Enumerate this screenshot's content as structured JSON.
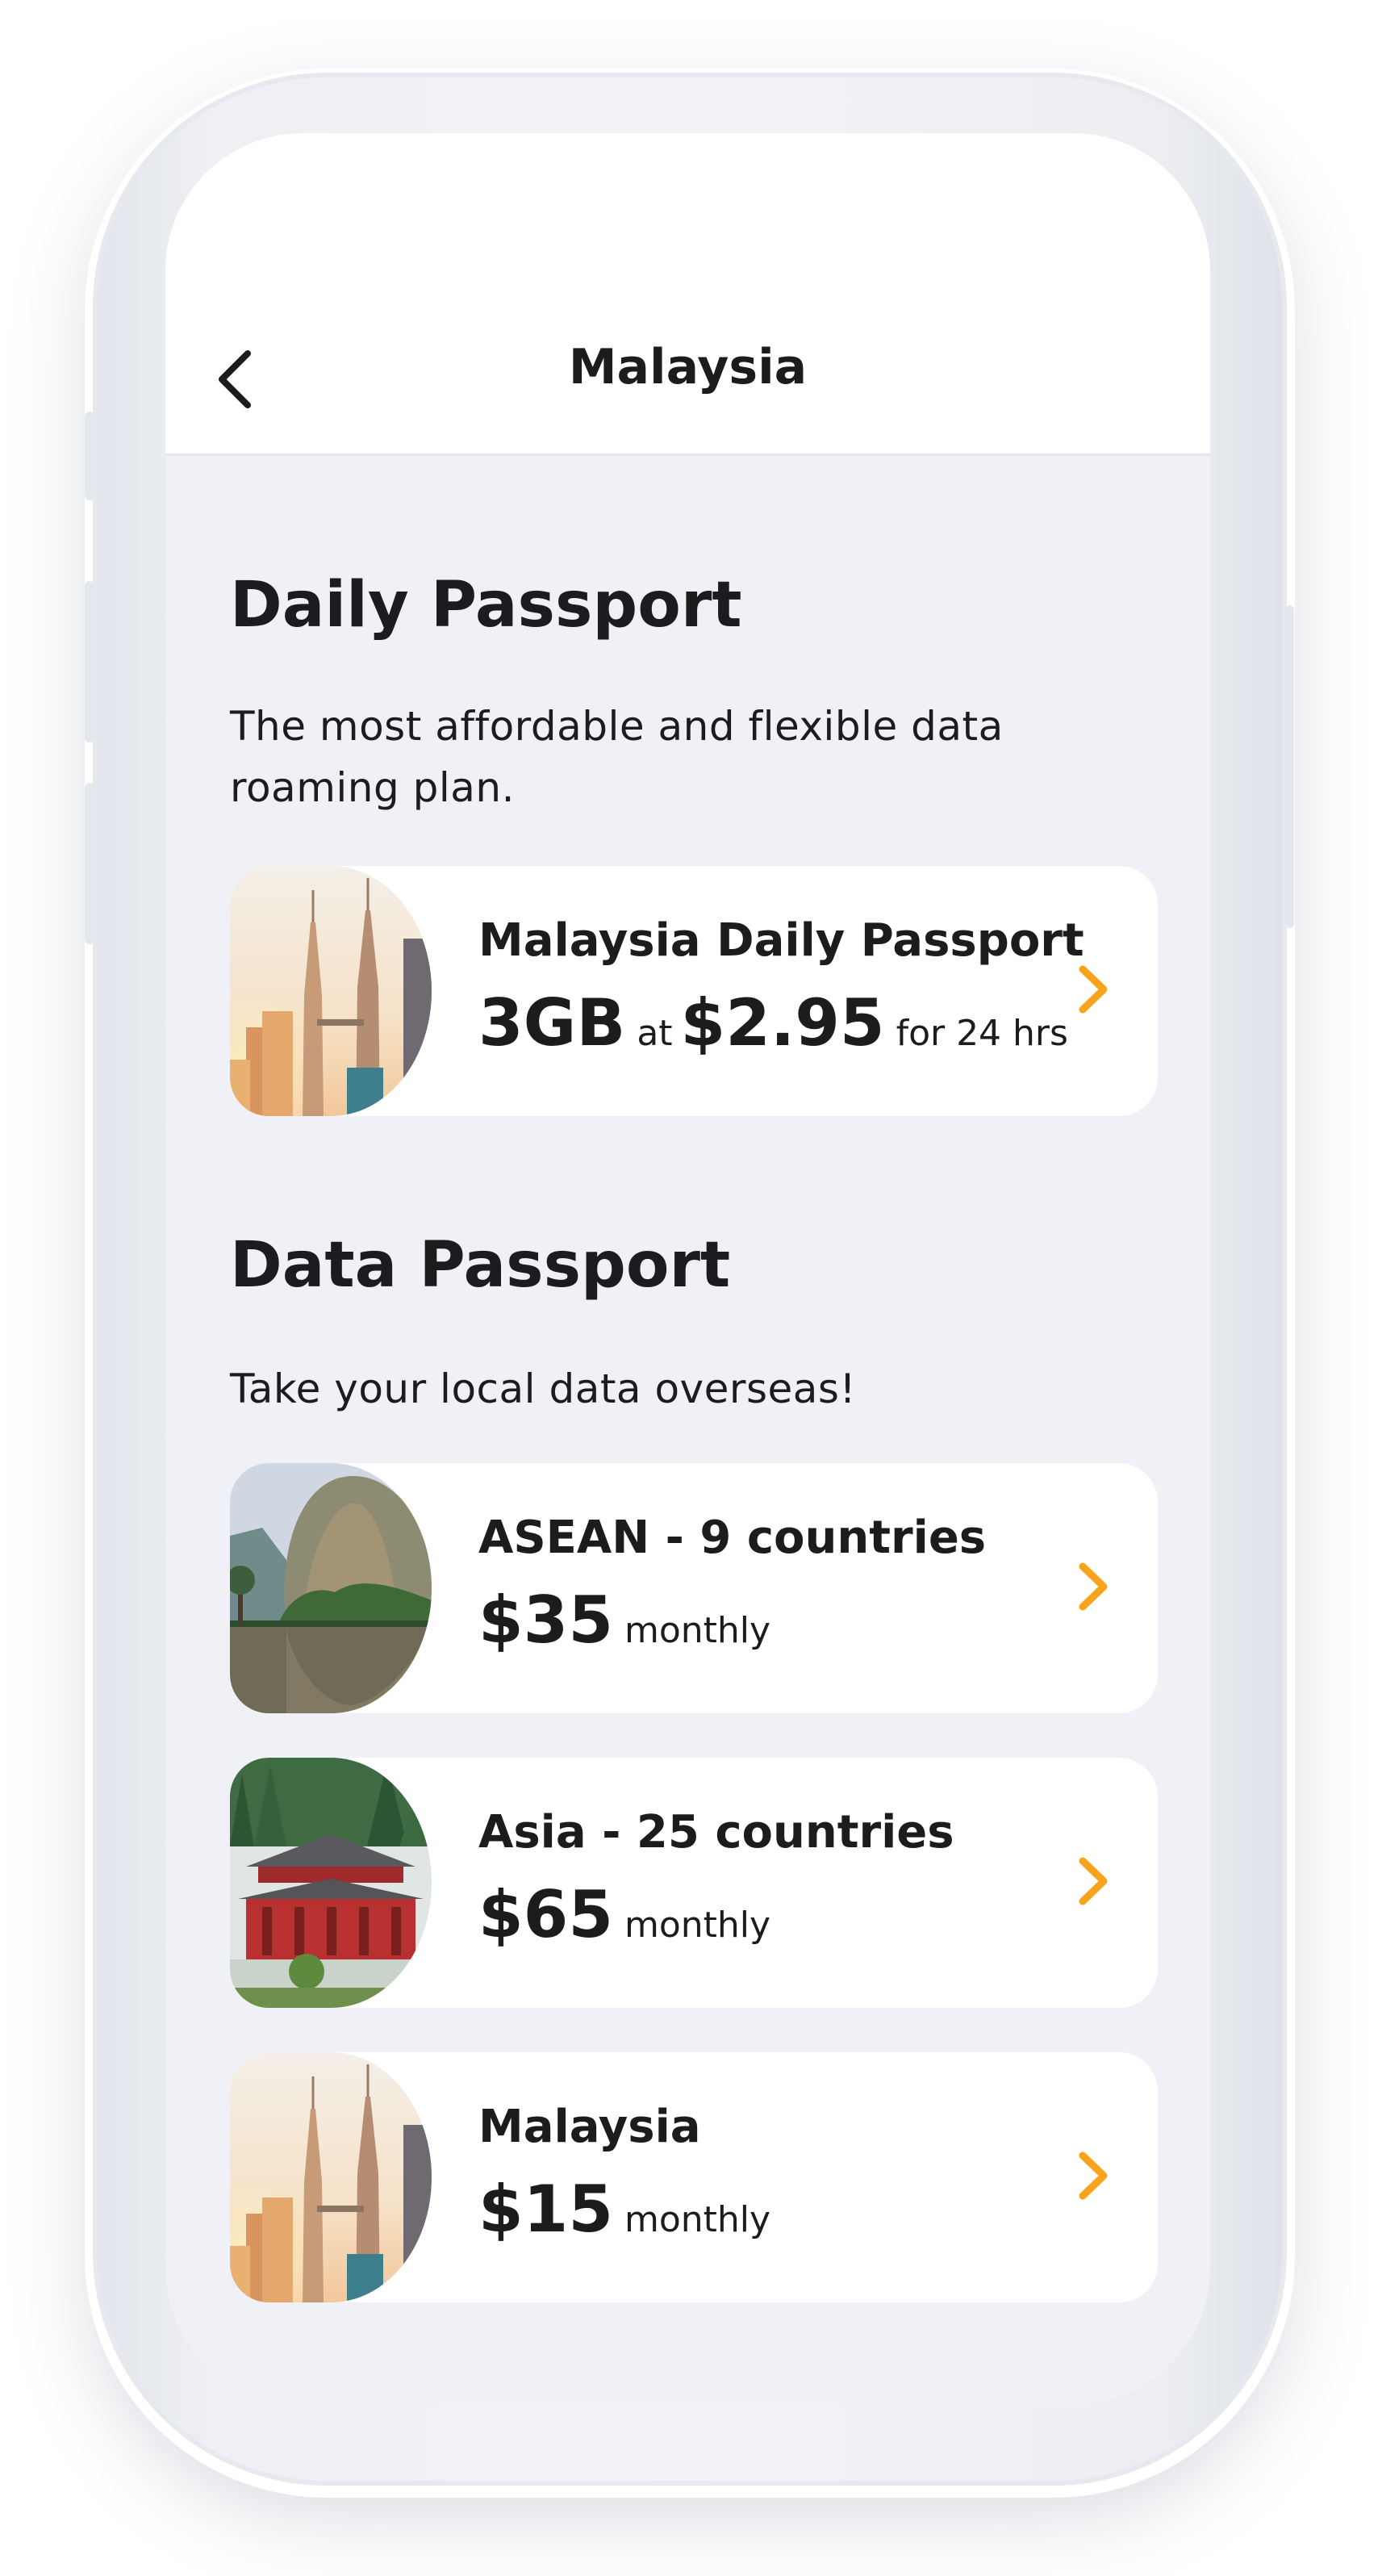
{
  "header": {
    "title": "Malaysia",
    "back_icon": "chevron-left-icon"
  },
  "daily_section": {
    "title": "Daily Passport",
    "description": "The most affordable and flexible data roaming plan."
  },
  "daily_card": {
    "title": "Malaysia Daily Passport",
    "data": "3GB",
    "at": "at",
    "price": "$2.95",
    "period": "for 24 hrs",
    "image": "petronas-towers-image"
  },
  "data_section": {
    "title": "Data Passport",
    "description": "Take your local data overseas!"
  },
  "plans": [
    {
      "title": "ASEAN - 9 countries",
      "price": "$35",
      "period": "monthly",
      "image": "karst-lake-image"
    },
    {
      "title": "Asia - 25 countries",
      "price": "$65",
      "period": "monthly",
      "image": "temple-image"
    },
    {
      "title": "Malaysia",
      "price": "$15",
      "period": "monthly",
      "image": "petronas-towers-image"
    }
  ],
  "colors": {
    "accent": "#f7a31c",
    "background": "#f0f1f6",
    "card": "#ffffff",
    "text": "#1c1c1e"
  }
}
